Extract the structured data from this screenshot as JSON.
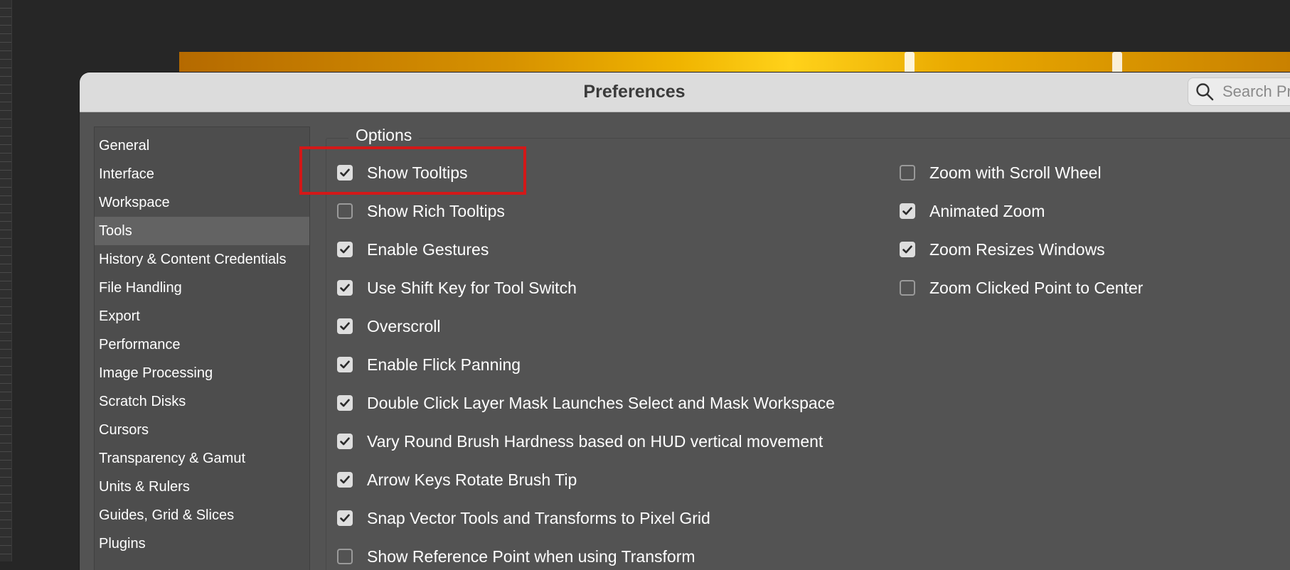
{
  "dialog": {
    "title": "Preferences",
    "search_placeholder": "Search Preferences"
  },
  "sidebar": {
    "selected": "Tools",
    "items": [
      {
        "label": "General"
      },
      {
        "label": "Interface"
      },
      {
        "label": "Workspace"
      },
      {
        "label": "Tools"
      },
      {
        "label": "History & Content Credentials"
      },
      {
        "label": "File Handling"
      },
      {
        "label": "Export"
      },
      {
        "label": "Performance"
      },
      {
        "label": "Image Processing"
      },
      {
        "label": "Scratch Disks"
      },
      {
        "label": "Cursors"
      },
      {
        "label": "Transparency & Gamut"
      },
      {
        "label": "Units & Rulers"
      },
      {
        "label": "Guides, Grid & Slices"
      },
      {
        "label": "Plugins"
      }
    ]
  },
  "options": {
    "group_label": "Options",
    "left": [
      {
        "label": "Show Tooltips",
        "checked": true
      },
      {
        "label": "Show Rich Tooltips",
        "checked": false
      },
      {
        "label": "Enable Gestures",
        "checked": true
      },
      {
        "label": "Use Shift Key for Tool Switch",
        "checked": true
      },
      {
        "label": "Overscroll",
        "checked": true
      },
      {
        "label": "Enable Flick Panning",
        "checked": true
      },
      {
        "label": "Double Click Layer Mask Launches Select and Mask Workspace",
        "checked": true
      },
      {
        "label": "Vary Round Brush Hardness based on HUD vertical movement",
        "checked": true
      },
      {
        "label": "Arrow Keys Rotate Brush Tip",
        "checked": true
      },
      {
        "label": "Snap Vector Tools and Transforms to Pixel Grid",
        "checked": true
      },
      {
        "label": "Show Reference Point when using Transform",
        "checked": false
      }
    ],
    "right": [
      {
        "label": "Zoom with Scroll Wheel",
        "checked": false
      },
      {
        "label": "Animated Zoom",
        "checked": true
      },
      {
        "label": "Zoom Resizes Windows",
        "checked": true
      },
      {
        "label": "Zoom Clicked Point to Center",
        "checked": false
      }
    ]
  },
  "colors": {
    "app_background": "#262626",
    "dialog_background": "#535353",
    "titlebar": "#dcdcdc",
    "highlight_box": "#d31818"
  }
}
